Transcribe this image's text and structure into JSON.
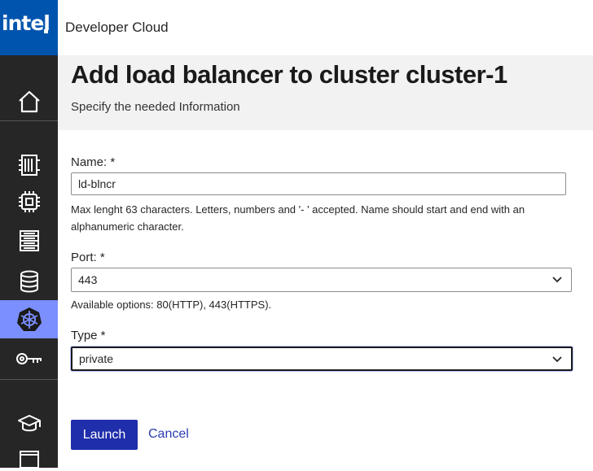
{
  "brand": {
    "logo_text": "intel"
  },
  "app": {
    "title": "Developer Cloud"
  },
  "header": {
    "title": "Add load balancer to cluster cluster-1",
    "subtitle": "Specify the needed Information"
  },
  "sidebar": {
    "items": [
      {
        "name": "home",
        "icon": "home-icon"
      },
      {
        "name": "compute",
        "icon": "server-rack-icon"
      },
      {
        "name": "hardware",
        "icon": "cpu-chip-icon"
      },
      {
        "name": "storage",
        "icon": "storage-list-icon"
      },
      {
        "name": "database",
        "icon": "database-icon"
      },
      {
        "name": "kubernetes",
        "icon": "kubernetes-icon",
        "active": true
      },
      {
        "name": "keys",
        "icon": "key-icon"
      },
      {
        "name": "learning",
        "icon": "graduation-cap-icon"
      },
      {
        "name": "window",
        "icon": "window-icon"
      }
    ],
    "active_color": "#7b8fff"
  },
  "form": {
    "name_label": "Name: *",
    "name_value": "ld-blncr",
    "name_help": "Max lenght 63 characters. Letters, numbers and '- ' accepted. Name should start and end with an alphanumeric character.",
    "port_label": "Port: *",
    "port_value": "443",
    "port_help": "Available options: 80(HTTP), 443(HTTPS).",
    "type_label": "Type *",
    "type_value": "private"
  },
  "actions": {
    "launch_label": "Launch",
    "cancel_label": "Cancel"
  },
  "colors": {
    "brand_blue": "#0054ae",
    "sidebar_bg": "#262626",
    "primary_button": "#1f2eaa",
    "link": "#2b3cb0"
  }
}
